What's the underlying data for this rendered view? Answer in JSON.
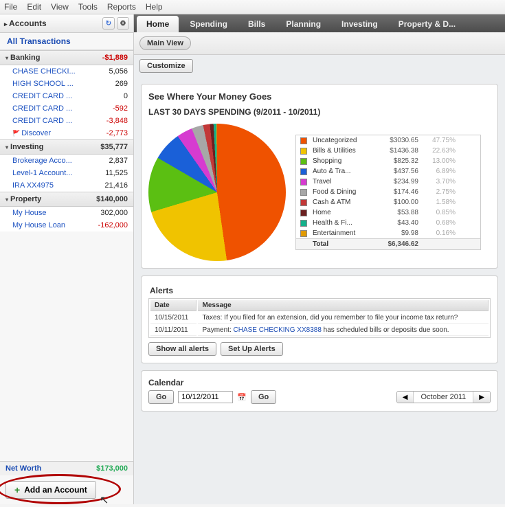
{
  "menu": [
    "File",
    "Edit",
    "View",
    "Tools",
    "Reports",
    "Help"
  ],
  "sidebar": {
    "title": "Accounts",
    "all_transactions": "All Transactions",
    "sections": [
      {
        "name": "Banking",
        "total": "-$1,889",
        "neg": true,
        "accounts": [
          {
            "n": "CHASE CHECKI...",
            "b": "5,056"
          },
          {
            "n": "HIGH SCHOOL ...",
            "b": "269"
          },
          {
            "n": "CREDIT CARD ...",
            "b": "0"
          },
          {
            "n": "CREDIT CARD ...",
            "b": "-592",
            "neg": true
          },
          {
            "n": "CREDIT CARD ...",
            "b": "-3,848",
            "neg": true
          },
          {
            "n": "Discover",
            "b": "-2,773",
            "neg": true,
            "flag": true
          }
        ]
      },
      {
        "name": "Investing",
        "total": "$35,777",
        "accounts": [
          {
            "n": "Brokerage Acco...",
            "b": "2,837"
          },
          {
            "n": "Level-1 Account...",
            "b": "11,525"
          },
          {
            "n": "IRA XX4975",
            "b": "21,416"
          }
        ]
      },
      {
        "name": "Property",
        "total": "$140,000",
        "accounts": [
          {
            "n": "My House",
            "b": "302,000"
          },
          {
            "n": "My House Loan",
            "b": "-162,000",
            "neg": true
          }
        ]
      }
    ],
    "networth_label": "Net Worth",
    "networth_value": "$173,000",
    "add_account": "Add an Account"
  },
  "tabs": [
    "Home",
    "Spending",
    "Bills",
    "Planning",
    "Investing",
    "Property & D..."
  ],
  "main_view": "Main View",
  "customize": "Customize",
  "spending": {
    "heading": "See Where Your Money Goes",
    "subtitle": "LAST 30 DAYS SPENDING (9/2011 - 10/2011)"
  },
  "chart_data": {
    "type": "pie",
    "title": "LAST 30 DAYS SPENDING (9/2011 - 10/2011)",
    "series": [
      {
        "name": "Uncategorized",
        "value": 3030.65,
        "pct": 47.75,
        "color": "#ef5200"
      },
      {
        "name": "Bills & Utilities",
        "value": 1436.38,
        "pct": 22.63,
        "color": "#f0c300"
      },
      {
        "name": "Shopping",
        "value": 825.32,
        "pct": 13.0,
        "color": "#5bbf12"
      },
      {
        "name": "Auto & Tra...",
        "value": 437.56,
        "pct": 6.89,
        "color": "#1a60d8"
      },
      {
        "name": "Travel",
        "value": 234.99,
        "pct": 3.7,
        "color": "#d63bd0"
      },
      {
        "name": "Food & Dining",
        "value": 174.46,
        "pct": 2.75,
        "color": "#a7a7a7"
      },
      {
        "name": "Cash & ATM",
        "value": 100.0,
        "pct": 1.58,
        "color": "#c23838"
      },
      {
        "name": "Home",
        "value": 53.88,
        "pct": 0.85,
        "color": "#6b2020"
      },
      {
        "name": "Health & Fi...",
        "value": 43.4,
        "pct": 0.68,
        "color": "#15b08a"
      },
      {
        "name": "Entertainment",
        "value": 9.98,
        "pct": 0.16,
        "color": "#e09a00"
      }
    ],
    "total_label": "Total",
    "total": "$6,346.62"
  },
  "alerts": {
    "title": "Alerts",
    "cols": [
      "Date",
      "Message"
    ],
    "rows": [
      {
        "date": "10/15/2011",
        "msg_pre": "Taxes: If you filed for an extension, did you remember to file your income tax return?"
      },
      {
        "date": "10/11/2011",
        "msg_pre": "Payment: ",
        "link": "CHASE CHECKING XX8388",
        "msg_post": " has scheduled bills or deposits due soon."
      }
    ],
    "show_all": "Show all alerts",
    "setup": "Set Up Alerts"
  },
  "calendar": {
    "title": "Calendar",
    "go": "Go",
    "date": "10/12/2011",
    "month": "October 2011"
  }
}
